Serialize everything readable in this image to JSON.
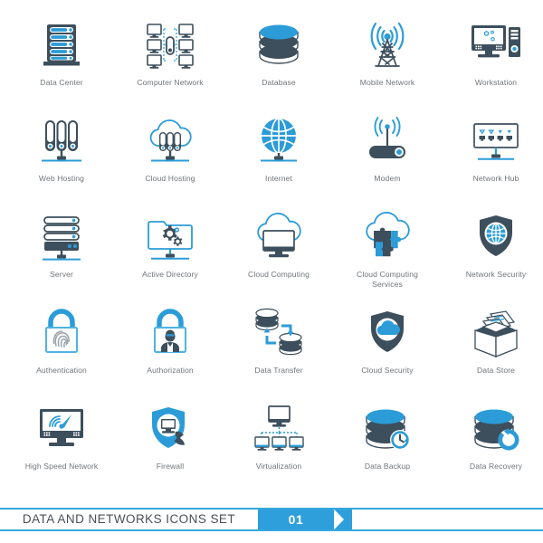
{
  "sheet": {
    "title": "Data and Networks Icons Set",
    "colors": {
      "accent_blue": "#2b9cd8",
      "light_blue": "#4fb3e5",
      "dark_slate": "#3d4f5c",
      "label_gray": "#70757a",
      "banner_blue": "#2e9fdb",
      "white": "#ffffff"
    }
  },
  "footer": {
    "title": "DATA AND NETWORKS ICONS SET",
    "number": "01"
  },
  "icons": [
    {
      "id": "data-center",
      "label": "Data Center"
    },
    {
      "id": "computer-network",
      "label": "Computer Network"
    },
    {
      "id": "database",
      "label": "Database"
    },
    {
      "id": "mobile-network",
      "label": "Mobile Network"
    },
    {
      "id": "workstation",
      "label": "Workstation"
    },
    {
      "id": "web-hosting",
      "label": "Web Hosting"
    },
    {
      "id": "cloud-hosting",
      "label": "Cloud Hosting"
    },
    {
      "id": "internet",
      "label": "Internet"
    },
    {
      "id": "modem",
      "label": "Modem"
    },
    {
      "id": "network-hub",
      "label": "Network Hub"
    },
    {
      "id": "server",
      "label": "Server"
    },
    {
      "id": "active-directory",
      "label": "Active Directory"
    },
    {
      "id": "cloud-computing",
      "label": "Cloud Computing"
    },
    {
      "id": "cloud-computing-services",
      "label": "Cloud Computing\nServices"
    },
    {
      "id": "network-security",
      "label": "Network Security"
    },
    {
      "id": "authentication",
      "label": "Authentication"
    },
    {
      "id": "authorization",
      "label": "Authorization"
    },
    {
      "id": "data-transfer",
      "label": "Data Transfer"
    },
    {
      "id": "cloud-security",
      "label": "Cloud Security"
    },
    {
      "id": "data-store",
      "label": "Data Store"
    },
    {
      "id": "high-speed-network",
      "label": "High Speed Network"
    },
    {
      "id": "firewall",
      "label": "Firewall"
    },
    {
      "id": "virtualization",
      "label": "Virtualization"
    },
    {
      "id": "data-backup",
      "label": "Data Backup"
    },
    {
      "id": "data-recovery",
      "label": "Data Recovery"
    }
  ]
}
